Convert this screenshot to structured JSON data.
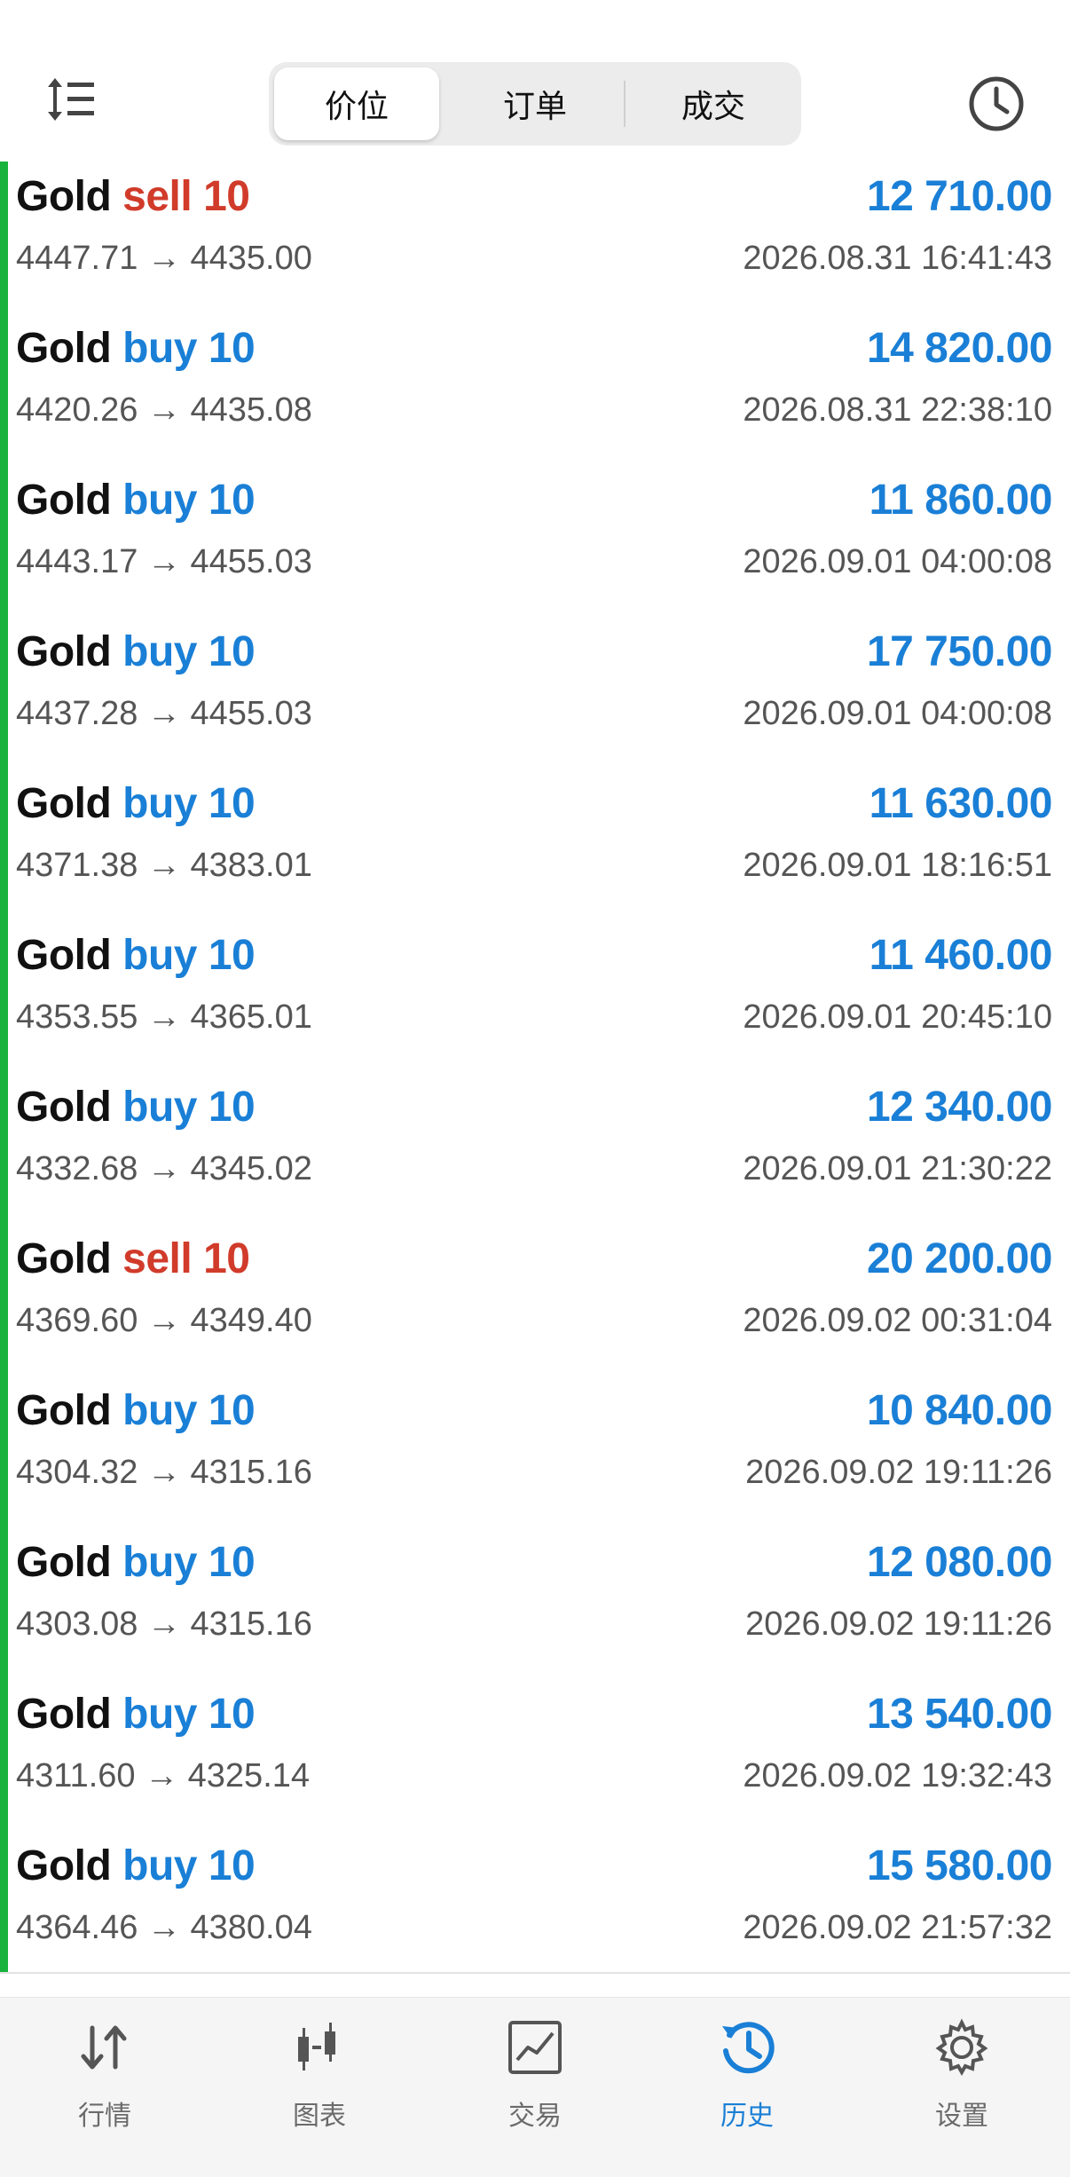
{
  "header": {
    "tabs": [
      {
        "label": "价位",
        "active": true
      },
      {
        "label": "订单",
        "active": false
      },
      {
        "label": "成交",
        "active": false
      }
    ],
    "sort_icon": "sort-icon",
    "history_icon": "clock-icon"
  },
  "colors": {
    "sell": "#d13b2a",
    "buy": "#1a7fd6",
    "profit": "#1a7fd6",
    "indicator": "#17b33c"
  },
  "trades": [
    {
      "symbol": "Gold",
      "side": "sell",
      "volume": "10",
      "prices": "4447.71 → 4435.00",
      "profit": "12 710.00",
      "time": "2026.08.31 16:41:43"
    },
    {
      "symbol": "Gold",
      "side": "buy",
      "volume": "10",
      "prices": "4420.26 → 4435.08",
      "profit": "14 820.00",
      "time": "2026.08.31 22:38:10"
    },
    {
      "symbol": "Gold",
      "side": "buy",
      "volume": "10",
      "prices": "4443.17 → 4455.03",
      "profit": "11 860.00",
      "time": "2026.09.01 04:00:08"
    },
    {
      "symbol": "Gold",
      "side": "buy",
      "volume": "10",
      "prices": "4437.28 → 4455.03",
      "profit": "17 750.00",
      "time": "2026.09.01 04:00:08"
    },
    {
      "symbol": "Gold",
      "side": "buy",
      "volume": "10",
      "prices": "4371.38 → 4383.01",
      "profit": "11 630.00",
      "time": "2026.09.01 18:16:51"
    },
    {
      "symbol": "Gold",
      "side": "buy",
      "volume": "10",
      "prices": "4353.55 → 4365.01",
      "profit": "11 460.00",
      "time": "2026.09.01 20:45:10"
    },
    {
      "symbol": "Gold",
      "side": "buy",
      "volume": "10",
      "prices": "4332.68 → 4345.02",
      "profit": "12 340.00",
      "time": "2026.09.01 21:30:22"
    },
    {
      "symbol": "Gold",
      "side": "sell",
      "volume": "10",
      "prices": "4369.60 → 4349.40",
      "profit": "20 200.00",
      "time": "2026.09.02 00:31:04"
    },
    {
      "symbol": "Gold",
      "side": "buy",
      "volume": "10",
      "prices": "4304.32 → 4315.16",
      "profit": "10 840.00",
      "time": "2026.09.02 19:11:26"
    },
    {
      "symbol": "Gold",
      "side": "buy",
      "volume": "10",
      "prices": "4303.08 → 4315.16",
      "profit": "12 080.00",
      "time": "2026.09.02 19:11:26"
    },
    {
      "symbol": "Gold",
      "side": "buy",
      "volume": "10",
      "prices": "4311.60 → 4325.14",
      "profit": "13 540.00",
      "time": "2026.09.02 19:32:43"
    },
    {
      "symbol": "Gold",
      "side": "buy",
      "volume": "10",
      "prices": "4364.46 → 4380.04",
      "profit": "15 580.00",
      "time": "2026.09.02 21:57:32"
    }
  ],
  "tabbar": [
    {
      "label": "行情",
      "icon": "quotes-icon",
      "active": false
    },
    {
      "label": "图表",
      "icon": "chart-icon",
      "active": false
    },
    {
      "label": "交易",
      "icon": "trade-icon",
      "active": false
    },
    {
      "label": "历史",
      "icon": "history-icon",
      "active": true
    },
    {
      "label": "设置",
      "icon": "settings-icon",
      "active": false
    }
  ]
}
